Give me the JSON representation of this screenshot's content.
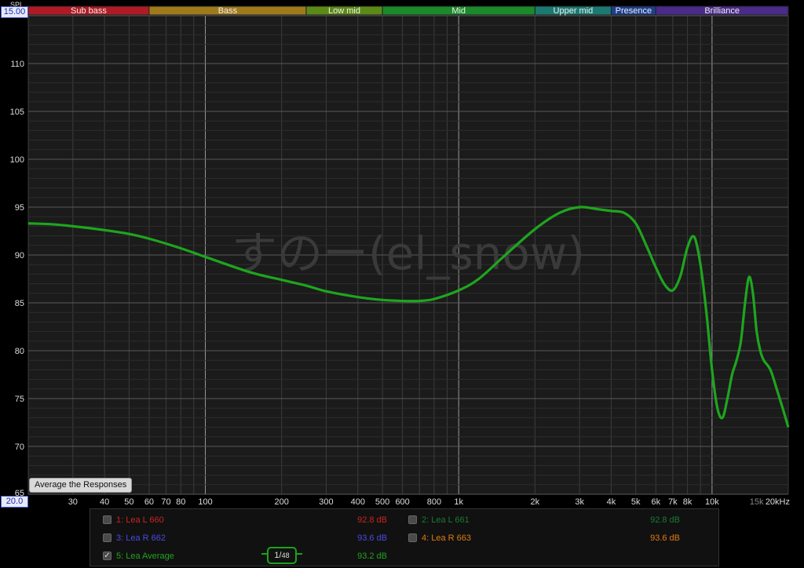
{
  "chart_data": {
    "type": "line",
    "x_scale": "log",
    "xlim": [
      20,
      20000
    ],
    "ylim": [
      65,
      115
    ],
    "ylabel": "SPL",
    "x_ticks": [
      {
        "v": 20,
        "label": "20.0"
      },
      {
        "v": 30,
        "label": "30"
      },
      {
        "v": 40,
        "label": "40"
      },
      {
        "v": 50,
        "label": "50"
      },
      {
        "v": 60,
        "label": "60"
      },
      {
        "v": 70,
        "label": "70"
      },
      {
        "v": 80,
        "label": "80"
      },
      {
        "v": 100,
        "label": "100"
      },
      {
        "v": 200,
        "label": "200"
      },
      {
        "v": 300,
        "label": "300"
      },
      {
        "v": 400,
        "label": "400"
      },
      {
        "v": 500,
        "label": "500"
      },
      {
        "v": 600,
        "label": "600"
      },
      {
        "v": 800,
        "label": "800"
      },
      {
        "v": 1000,
        "label": "1k"
      },
      {
        "v": 2000,
        "label": "2k"
      },
      {
        "v": 3000,
        "label": "3k"
      },
      {
        "v": 4000,
        "label": "4k"
      },
      {
        "v": 5000,
        "label": "5k"
      },
      {
        "v": 6000,
        "label": "6k"
      },
      {
        "v": 7000,
        "label": "7k"
      },
      {
        "v": 8000,
        "label": "8k"
      },
      {
        "v": 10000,
        "label": "10k"
      },
      {
        "v": 15000,
        "label": "15k"
      },
      {
        "v": 20000,
        "label": "20kHz"
      }
    ],
    "y_ticks": [
      70,
      75,
      80,
      85,
      90,
      95,
      100,
      105,
      110
    ],
    "bands": [
      {
        "name": "Sub bass",
        "from": 20,
        "to": 60,
        "color": "#b01a24"
      },
      {
        "name": "Bass",
        "from": 60,
        "to": 250,
        "color": "#a07a1a"
      },
      {
        "name": "Low mid",
        "from": 250,
        "to": 500,
        "color": "#5c8a16"
      },
      {
        "name": "Mid",
        "from": 500,
        "to": 2000,
        "color": "#1a8a2a"
      },
      {
        "name": "Upper mid",
        "from": 2000,
        "to": 4000,
        "color": "#1a7a72"
      },
      {
        "name": "Presence",
        "from": 4000,
        "to": 6000,
        "color": "#1d3f8e"
      },
      {
        "name": "Brilliance",
        "from": 6000,
        "to": 20000,
        "color": "#4a2a8a"
      }
    ],
    "watermark": "すのー(el_snow)",
    "series": [
      {
        "name": "5: Lea Average",
        "color": "#1ea51e",
        "x": [
          20,
          25,
          30,
          40,
          50,
          60,
          80,
          100,
          150,
          200,
          250,
          300,
          400,
          500,
          600,
          700,
          800,
          1000,
          1200,
          1500,
          2000,
          2500,
          3000,
          3500,
          4000,
          4500,
          5000,
          5500,
          6000,
          6500,
          7000,
          7500,
          8000,
          8500,
          9000,
          9500,
          10000,
          10500,
          11000,
          11500,
          12000,
          12500,
          13000,
          13500,
          14000,
          14500,
          15000,
          15500,
          16000,
          17000,
          18000,
          19000,
          20000
        ],
        "y": [
          93.3,
          93.2,
          93.0,
          92.6,
          92.2,
          91.7,
          90.7,
          89.8,
          88.2,
          87.4,
          86.8,
          86.2,
          85.6,
          85.3,
          85.2,
          85.2,
          85.4,
          86.3,
          87.5,
          89.8,
          92.7,
          94.4,
          95.0,
          94.8,
          94.6,
          94.4,
          93.3,
          91.0,
          88.7,
          86.9,
          86.3,
          87.8,
          90.8,
          91.9,
          89.0,
          84.0,
          78.0,
          74.0,
          73.0,
          75.0,
          77.5,
          79.0,
          81.0,
          85.0,
          87.7,
          86.0,
          82.0,
          80.0,
          79.0,
          78.0,
          76.0,
          74.0,
          72.0
        ]
      }
    ]
  },
  "header": {
    "spl_label": "SPL",
    "top_value": "15.00"
  },
  "footer": {
    "bottom_value": "20.0"
  },
  "buttons": {
    "average": "Average the Responses"
  },
  "smoothing": {
    "numerator": "1",
    "denominator": "48"
  },
  "legend": [
    {
      "label": "1: Lea L 660",
      "value": "92.8 dB",
      "color": "#c8261e",
      "checked": false
    },
    {
      "label": "2: Lea L 661",
      "value": "92.8 dB",
      "color": "#1a7a34",
      "checked": false
    },
    {
      "label": "3: Lea R 662",
      "value": "93.6 dB",
      "color": "#4a4ae6",
      "checked": false
    },
    {
      "label": "4: Lea R 663",
      "value": "93.6 dB",
      "color": "#e07a10",
      "checked": false
    },
    {
      "label": "5: Lea Average",
      "value": "93.2 dB",
      "color": "#1ea51e",
      "checked": true
    }
  ]
}
